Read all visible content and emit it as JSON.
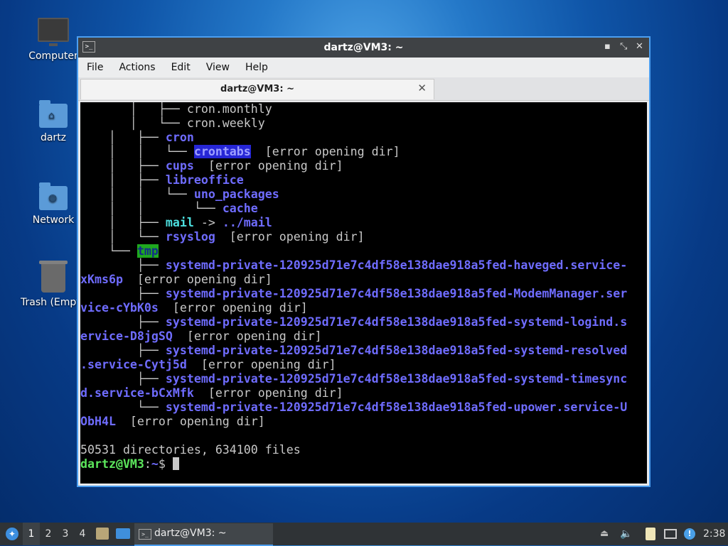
{
  "desktop": {
    "icons": [
      {
        "label": "Computer",
        "icon": "computer-icon"
      },
      {
        "label": "dartz",
        "icon": "home-folder-icon"
      },
      {
        "label": "Network",
        "icon": "network-folder-icon"
      },
      {
        "label": "Trash (Empt",
        "icon": "trash-icon"
      }
    ]
  },
  "window": {
    "title": "dartz@VM3: ~",
    "controls": {
      "minimize": "▪",
      "maximize": "⤡",
      "close": "✕"
    },
    "menu": [
      "File",
      "Actions",
      "Edit",
      "View",
      "Help"
    ],
    "tab": {
      "label": "dartz@VM3: ~",
      "close": "✕"
    }
  },
  "terminal": {
    "tree": [
      {
        "prefix": "       │   ├── ",
        "segs": [
          {
            "t": "cron.monthly",
            "c": ""
          }
        ]
      },
      {
        "prefix": "       │   └── ",
        "segs": [
          {
            "t": "cron.weekly",
            "c": ""
          }
        ]
      },
      {
        "prefix": "    │   ├── ",
        "segs": [
          {
            "t": "cron",
            "c": "dir"
          }
        ]
      },
      {
        "prefix": "    │   │   └── ",
        "segs": [
          {
            "t": "crontabs",
            "c": "sel"
          },
          {
            "t": "  [error opening dir]",
            "c": ""
          }
        ]
      },
      {
        "prefix": "    │   ├── ",
        "segs": [
          {
            "t": "cups",
            "c": "dir"
          },
          {
            "t": "  [error opening dir]",
            "c": ""
          }
        ]
      },
      {
        "prefix": "    │   ├── ",
        "segs": [
          {
            "t": "libreoffice",
            "c": "dir"
          }
        ]
      },
      {
        "prefix": "    │   │   └── ",
        "segs": [
          {
            "t": "uno_packages",
            "c": "dir"
          }
        ]
      },
      {
        "prefix": "    │   │       └── ",
        "segs": [
          {
            "t": "cache",
            "c": "dir"
          }
        ]
      },
      {
        "prefix": "    │   ├── ",
        "segs": [
          {
            "t": "mail",
            "c": "link"
          },
          {
            "t": " -> ",
            "c": ""
          },
          {
            "t": "../mail",
            "c": "dir"
          }
        ]
      },
      {
        "prefix": "    │   └── ",
        "segs": [
          {
            "t": "rsyslog",
            "c": "dir"
          },
          {
            "t": "  [error opening dir]",
            "c": ""
          }
        ]
      },
      {
        "prefix": "    └── ",
        "segs": [
          {
            "t": "tmp",
            "c": "tmp"
          }
        ]
      },
      {
        "prefix": "        ├── ",
        "segs": [
          {
            "t": "systemd-private-120925d71e7c4df58e138dae918a5fed-haveged.service-",
            "c": "dir"
          }
        ]
      },
      {
        "prefix": "",
        "segs": [
          {
            "t": "xKms6p",
            "c": "dir"
          },
          {
            "t": "  [error opening dir]",
            "c": ""
          }
        ]
      },
      {
        "prefix": "        ├── ",
        "segs": [
          {
            "t": "systemd-private-120925d71e7c4df58e138dae918a5fed-ModemManager.ser",
            "c": "dir"
          }
        ]
      },
      {
        "prefix": "",
        "segs": [
          {
            "t": "vice-cYbK0s",
            "c": "dir"
          },
          {
            "t": "  [error opening dir]",
            "c": ""
          }
        ]
      },
      {
        "prefix": "        ├── ",
        "segs": [
          {
            "t": "systemd-private-120925d71e7c4df58e138dae918a5fed-systemd-logind.s",
            "c": "dir"
          }
        ]
      },
      {
        "prefix": "",
        "segs": [
          {
            "t": "ervice-D8jgSQ",
            "c": "dir"
          },
          {
            "t": "  [error opening dir]",
            "c": ""
          }
        ]
      },
      {
        "prefix": "        ├── ",
        "segs": [
          {
            "t": "systemd-private-120925d71e7c4df58e138dae918a5fed-systemd-resolved",
            "c": "dir"
          }
        ]
      },
      {
        "prefix": "",
        "segs": [
          {
            "t": ".service-Cytj5d",
            "c": "dir"
          },
          {
            "t": "  [error opening dir]",
            "c": ""
          }
        ]
      },
      {
        "prefix": "        ├── ",
        "segs": [
          {
            "t": "systemd-private-120925d71e7c4df58e138dae918a5fed-systemd-timesync",
            "c": "dir"
          }
        ]
      },
      {
        "prefix": "",
        "segs": [
          {
            "t": "d.service-bCxMfk",
            "c": "dir"
          },
          {
            "t": "  [error opening dir]",
            "c": ""
          }
        ]
      },
      {
        "prefix": "        └── ",
        "segs": [
          {
            "t": "systemd-private-120925d71e7c4df58e138dae918a5fed-upower.service-U",
            "c": "dir"
          }
        ]
      },
      {
        "prefix": "",
        "segs": [
          {
            "t": "ObH4L",
            "c": "dir"
          },
          {
            "t": "  [error opening dir]",
            "c": ""
          }
        ]
      },
      {
        "prefix": "",
        "segs": [
          {
            "t": "",
            "c": ""
          }
        ]
      },
      {
        "prefix": "",
        "segs": [
          {
            "t": "50531 directories, 634100 files",
            "c": ""
          }
        ]
      }
    ],
    "prompt": {
      "user_host": "dartz@VM3",
      "sep": ":",
      "path": "~",
      "symbol": "$ "
    }
  },
  "taskbar": {
    "start_icon": "start-menu-icon",
    "workspaces": [
      "1",
      "2",
      "3",
      "4"
    ],
    "active_workspace": "1",
    "launchers": [
      "file-manager-icon",
      "show-desktop-icon"
    ],
    "task": {
      "label": "dartz@VM3: ~",
      "icon": "terminal-icon"
    },
    "tray": [
      "eject-icon",
      "volume-icon",
      "clipboard-icon",
      "network-icon",
      "update-icon"
    ],
    "clock": "2:38"
  }
}
